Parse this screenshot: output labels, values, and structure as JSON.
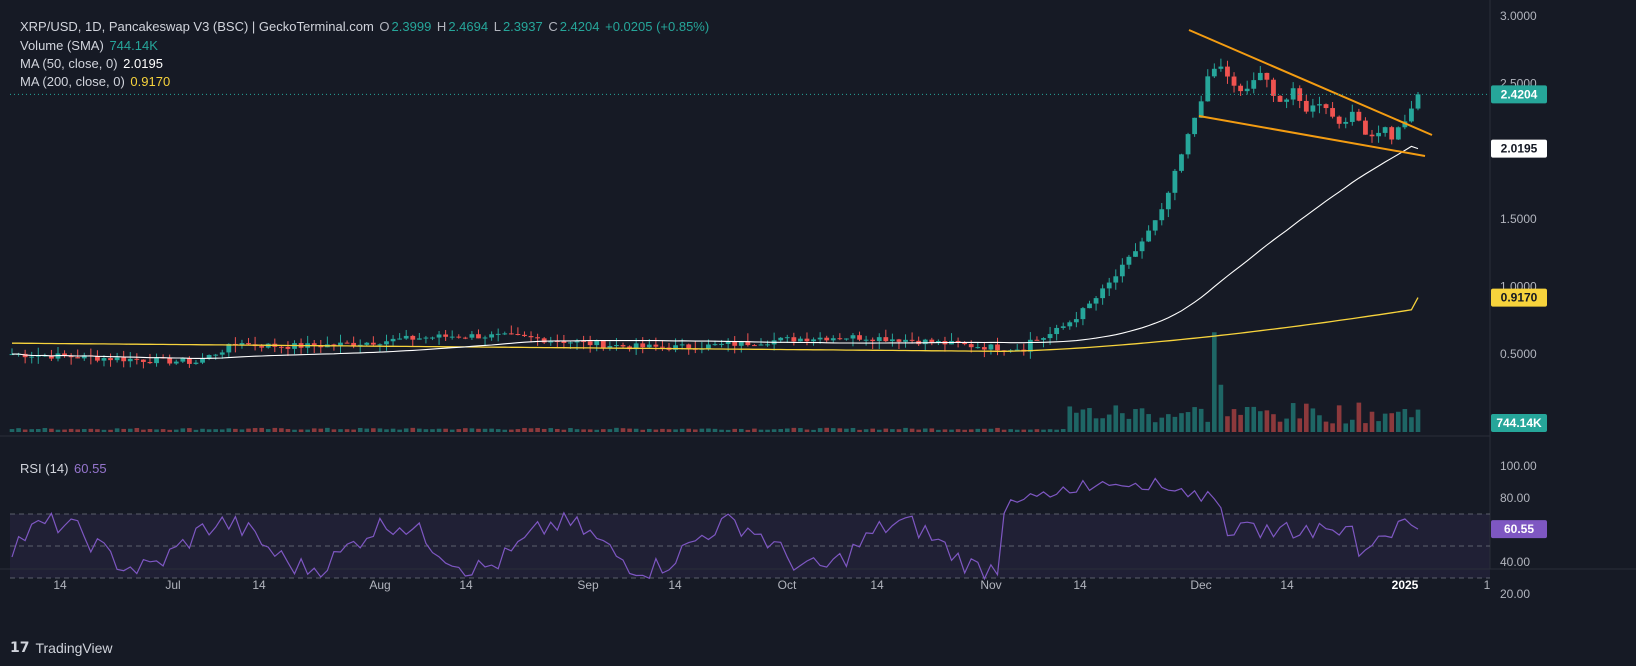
{
  "header": {
    "symbol_line": "XRP/USD, 1D, Pancakeswap V3 (BSC) | GeckoTerminal.com",
    "o_label": "O",
    "o_value": "2.3999",
    "h_label": "H",
    "h_value": "2.4694",
    "l_label": "L",
    "l_value": "2.3937",
    "c_label": "C",
    "c_value": "2.4204",
    "change": "+0.0205 (+0.85%)"
  },
  "indicators": {
    "volume_label": "Volume (SMA)",
    "volume_value": "744.14K",
    "ma50_label": "MA (50, close, 0)",
    "ma50_value": "2.0195",
    "ma200_label": "MA (200, close, 0)",
    "ma200_value": "0.9170",
    "rsi_label": "RSI (14)",
    "rsi_value": "60.55"
  },
  "price_axis": [
    "3.0000",
    "2.5000",
    "1.5000",
    "1.0000",
    "0.5000"
  ],
  "rsi_axis": [
    "100.00",
    "80.00",
    "40.00",
    "20.00"
  ],
  "badges": {
    "price": "2.4204",
    "ma50": "2.0195",
    "ma200": "0.9170",
    "volume": "744.14K",
    "rsi": "60.55"
  },
  "x_axis": [
    "14",
    "Jul",
    "14",
    "Aug",
    "14",
    "Sep",
    "14",
    "Oct",
    "14",
    "Nov",
    "14",
    "Dec",
    "14",
    "2025",
    "1"
  ],
  "footer": {
    "brand": "TradingView",
    "logo": "17"
  },
  "colors": {
    "background": "#161a25",
    "up": "#26a69a",
    "down": "#ef5350",
    "ma50": "#ffffff",
    "ma200": "#f7d33c",
    "rsi": "#7e57c2",
    "trendline": "#f39c12"
  },
  "chart_data": {
    "type": "candlestick",
    "interval": "1D",
    "price_ylim": [
      0.2,
      3.0
    ],
    "rsi_ylim": [
      20,
      100
    ],
    "rsi_bands": [
      30,
      50,
      70
    ],
    "x_ticks": [
      "14",
      "Jul",
      "14",
      "Aug",
      "14",
      "Sep",
      "14",
      "Oct",
      "14",
      "Nov",
      "14",
      "Dec",
      "14",
      "2025",
      "1"
    ],
    "last_close": 2.4204,
    "ma50_last": 2.0195,
    "ma200_last": 0.917,
    "volume_last": "744.14K",
    "rsi_last": 60.55
  }
}
